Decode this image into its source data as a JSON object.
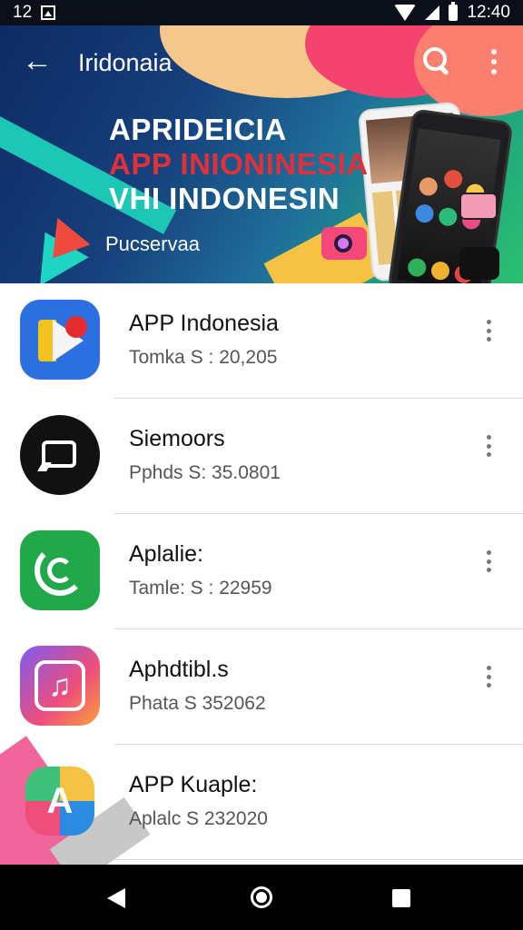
{
  "status_bar": {
    "left_text": "12",
    "time": "12:40"
  },
  "header": {
    "title": "Iridonaia",
    "banner": {
      "line1": "APRIDEICIA",
      "line2": "APP INIONINESIA",
      "line3": "VHI INDONESIN",
      "subtitle": "Pucservaa"
    },
    "icons": [
      "back-arrow-icon",
      "search-icon",
      "more-vert-icon"
    ]
  },
  "apps": [
    {
      "name": "APP Indonesia",
      "meta": "Tomka  S : 20,205",
      "icon": "maps-icon"
    },
    {
      "name": "Siemoors",
      "meta": "Pphds  S: 35.0801",
      "icon": "chat-icon"
    },
    {
      "name": "Aplalie:",
      "meta": "Tamle: S : 22959",
      "icon": "phone-icon"
    },
    {
      "name": "Aphdtibl.s",
      "meta": "Phata  S  352062",
      "icon": "music-icon"
    },
    {
      "name": "APP Kuaple:",
      "meta": "Aplalc  S  232020",
      "icon": "a-logo-icon"
    }
  ],
  "colors": {
    "banner_red": "#e0303a",
    "status_bg": "#0b0f1a",
    "nav_bg": "#000000"
  }
}
